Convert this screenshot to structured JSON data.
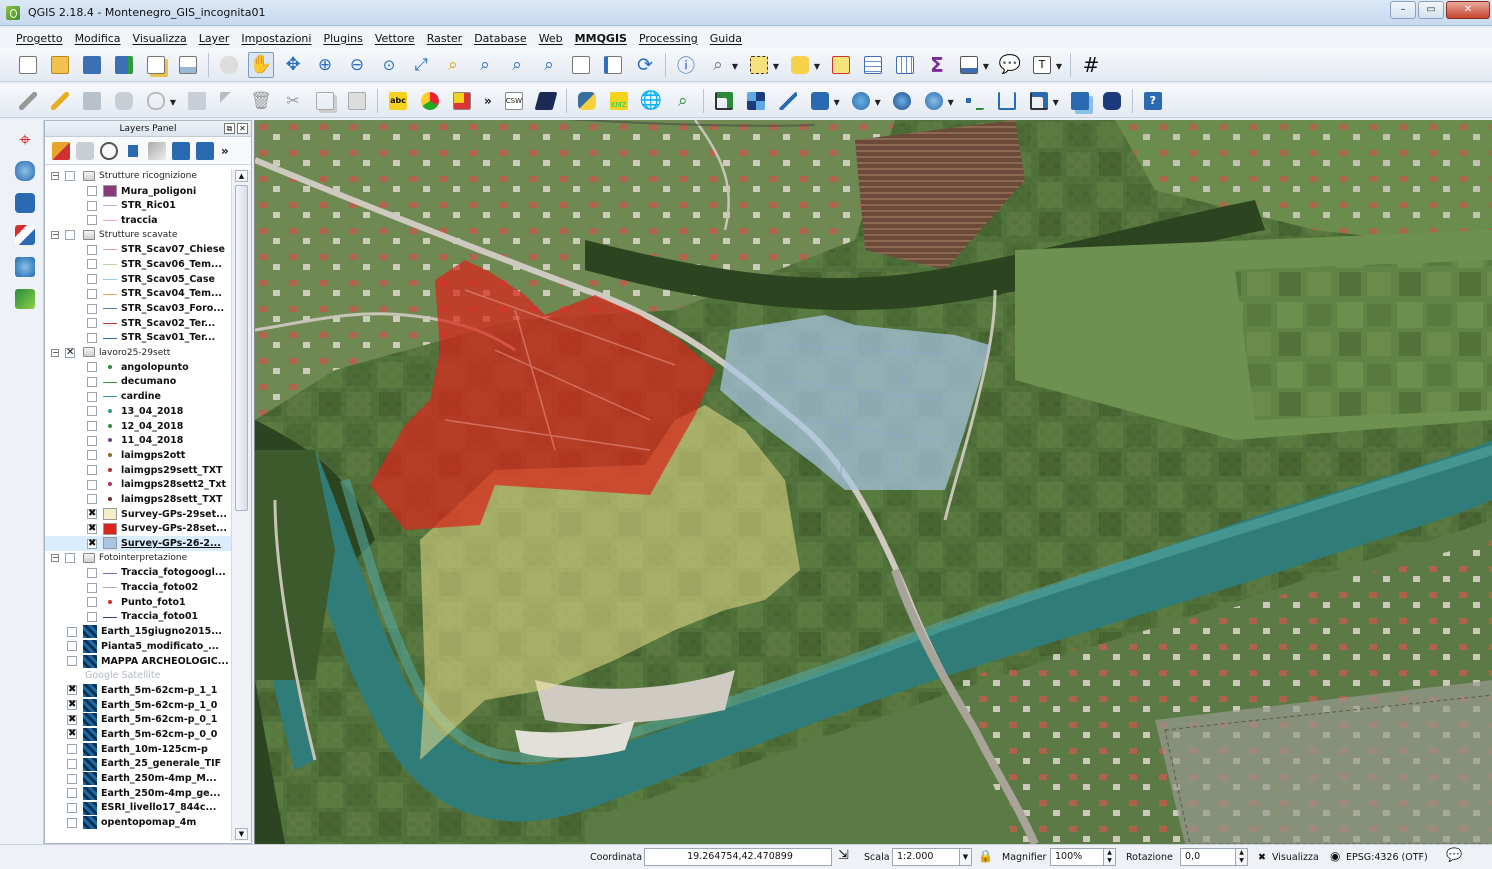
{
  "window": {
    "title": "QGIS 2.18.4 - Montenegro_GIS_incognita01",
    "buttons": [
      "–",
      "▭",
      "✕"
    ]
  },
  "menu": [
    "Progetto",
    "Modifica",
    "Visualizza",
    "Layer",
    "Impostazioni",
    "Plugins",
    "Vettore",
    "Raster",
    "Database",
    "Web",
    "MMQGIS",
    "Processing",
    "Guida"
  ],
  "toolbar_labels": {
    "spell_check": "abc",
    "csw": "CSW",
    "kmz": "KMZ",
    "overflow": "»"
  },
  "layers_panel": {
    "title": "Layers Panel",
    "float_btn": "⧉",
    "close_btn": "✕",
    "layers": [
      {
        "label": "Strutture ricognizione",
        "kind": "group",
        "level": 0,
        "expander": "−"
      },
      {
        "label": "Mura_poligoni",
        "kind": "fill",
        "level": 1,
        "color": "#8a3a7a"
      },
      {
        "label": "STR_Ric01",
        "kind": "line",
        "level": 1,
        "color": "#c9a5d6"
      },
      {
        "label": "traccia",
        "kind": "line",
        "level": 1,
        "color": "#e6a9b8"
      },
      {
        "label": "Strutture scavate",
        "kind": "group",
        "level": 0,
        "expander": "−"
      },
      {
        "label": "STR_Scav07_Chiese",
        "kind": "line",
        "level": 1,
        "color": "#d7a0b6"
      },
      {
        "label": "STR_Scav06_Tem...",
        "kind": "line",
        "level": 1,
        "color": "#b7d8a5"
      },
      {
        "label": "STR_Scav05_Case",
        "kind": "line",
        "level": 1,
        "color": "#9ec8e6"
      },
      {
        "label": "STR_Scav04_Tem...",
        "kind": "line",
        "level": 1,
        "color": "#f0a050"
      },
      {
        "label": "STR_Scav03_Foro...",
        "kind": "line",
        "level": 1,
        "color": "#5a7ac0"
      },
      {
        "label": "STR_Scav02_Ter...",
        "kind": "line",
        "level": 1,
        "color": "#c03030"
      },
      {
        "label": "STR_Scav01_Ter...",
        "kind": "line",
        "level": 1,
        "color": "#3070b0"
      },
      {
        "label": "lavoro25-29sett",
        "kind": "group",
        "level": 0,
        "expander": "−",
        "checked": "✕"
      },
      {
        "label": "angolopunto",
        "kind": "dot",
        "level": 1,
        "color": "#2e8b3a"
      },
      {
        "label": "decumano",
        "kind": "line",
        "level": 1,
        "color": "#3a9a3a"
      },
      {
        "label": "cardine",
        "kind": "line",
        "level": 1,
        "color": "#2aa0a0"
      },
      {
        "label": "13_04_2018",
        "kind": "dot",
        "level": 1,
        "color": "#2a9a8a"
      },
      {
        "label": "12_04_2018",
        "kind": "dot",
        "level": 1,
        "color": "#3a8a3a"
      },
      {
        "label": "11_04_2018",
        "kind": "dot",
        "level": 1,
        "color": "#7a3a8a"
      },
      {
        "label": "laimgps2ott",
        "kind": "dot",
        "level": 1,
        "color": "#8a6a2a"
      },
      {
        "label": "laimgps29sett_TXT",
        "kind": "dot",
        "level": 1,
        "color": "#b03030"
      },
      {
        "label": "laimgps28sett2_Txt",
        "kind": "dot",
        "level": 1,
        "color": "#b03060"
      },
      {
        "label": "laimgps28sett_TXT",
        "kind": "dot",
        "level": 1,
        "color": "#7a2a2a"
      },
      {
        "label": "Survey-GPs-29set...",
        "kind": "fill",
        "level": 1,
        "color": "#f3efc6",
        "checked": "✖"
      },
      {
        "label": "Survey-GPs-28set...",
        "kind": "fill",
        "level": 1,
        "color": "#d9261c",
        "checked": "✖"
      },
      {
        "label": "Survey-GPs-26-2...",
        "kind": "fill",
        "level": 1,
        "color": "#a9c5e2",
        "checked": "✖",
        "selected": true
      },
      {
        "label": "Fotointerpretazione",
        "kind": "group",
        "level": 0,
        "expander": "−"
      },
      {
        "label": "Traccia_fotogoogl...",
        "kind": "line",
        "level": 1,
        "color": "#7a6ab0"
      },
      {
        "label": "Traccia_foto02",
        "kind": "line",
        "level": 1,
        "color": "#c0a0c0"
      },
      {
        "label": "Punto_foto1",
        "kind": "dot",
        "level": 1,
        "color": "#d02a2a"
      },
      {
        "label": "Traccia_foto01",
        "kind": "line",
        "level": 1,
        "color": "#3a3a8a"
      },
      {
        "label": "Earth_15giugno2015...",
        "kind": "raster",
        "level": 0
      },
      {
        "label": "Pianta5_modificato_...",
        "kind": "raster",
        "level": 0
      },
      {
        "label": "MAPPA ARCHEOLOGIC...",
        "kind": "raster",
        "level": 0
      },
      {
        "label": "Google Satellite",
        "kind": "greyed",
        "level": 0
      },
      {
        "label": "Earth_5m-62cm-p_1_1",
        "kind": "raster",
        "level": 0,
        "checked": "✖"
      },
      {
        "label": "Earth_5m-62cm-p_1_0",
        "kind": "raster",
        "level": 0,
        "checked": "✖"
      },
      {
        "label": "Earth_5m-62cm-p_0_1",
        "kind": "raster",
        "level": 0,
        "checked": "✖"
      },
      {
        "label": "Earth_5m-62cm-p_0_0",
        "kind": "raster",
        "level": 0,
        "checked": "✖"
      },
      {
        "label": "Earth_10m-125cm-p",
        "kind": "raster",
        "level": 0
      },
      {
        "label": "Earth_25_generale_TIF",
        "kind": "raster",
        "level": 0
      },
      {
        "label": "Earth_250m-4mp_M...",
        "kind": "raster",
        "level": 0
      },
      {
        "label": "Earth_250m-4mp_ge...",
        "kind": "raster",
        "level": 0
      },
      {
        "label": "ESRI_livello17_844c...",
        "kind": "raster",
        "level": 0
      },
      {
        "label": "opentopomap_4m",
        "kind": "raster",
        "level": 0
      }
    ]
  },
  "statusbar": {
    "coord_label": "Coordinata",
    "coord_value": "19.264754,42.470899",
    "scale_label": "Scala",
    "scale_value": "1:2.000",
    "magnifier_label": "Magnifier",
    "magnifier_value": "100%",
    "rotation_label": "Rotazione",
    "rotation_value": "0,0",
    "render_label": "Visualizza",
    "render_checked": "✖",
    "crs_label": "EPSG:4326 (OTF)"
  },
  "colors": {
    "survey_29": "#e7dd8a",
    "survey_28": "#d9261c",
    "survey_26": "#a9c5e2",
    "accent": "#3399ff"
  }
}
